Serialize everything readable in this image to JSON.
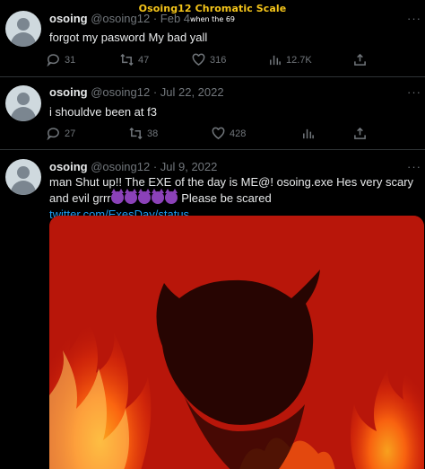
{
  "overlay": {
    "title": "Osoing12 Chromatic Scale",
    "subtitle": "when the 69"
  },
  "tweets": [
    {
      "name": "osoing",
      "handle": "@osoing12",
      "date": "· Feb 4",
      "text": "forgot my pasword My bad yall",
      "replies": "31",
      "retweets": "47",
      "likes": "316",
      "views": "12.7K"
    },
    {
      "name": "osoing",
      "handle": "@osoing12",
      "date": "· Jul 22, 2022",
      "text": "i shouldve been at f3",
      "replies": "27",
      "retweets": "38",
      "likes": "428",
      "views": ""
    },
    {
      "name": "osoing",
      "handle": "@osoing12",
      "date": "· Jul 9, 2022",
      "text_part1": "man Shut up!! The EXE of the day is ME@! osoing.exe Hes very scary and evil grrr",
      "text_part2": " Please be scared ",
      "link": "twitter.com/ExesDay/status...",
      "emoji_count": "5"
    }
  ],
  "icons": {
    "reply": "reply-icon",
    "retweet": "retweet-icon",
    "like": "heart-icon",
    "views": "views-icon",
    "share": "share-icon",
    "more": "more-icon",
    "emoji": "smiling-imp-emoji"
  },
  "colors": {
    "background": "#000000",
    "text": "#e7e9ea",
    "muted": "#71767b",
    "link": "#1d9bf0",
    "title": "#f5c51a",
    "media_red": "#c21a0c"
  }
}
